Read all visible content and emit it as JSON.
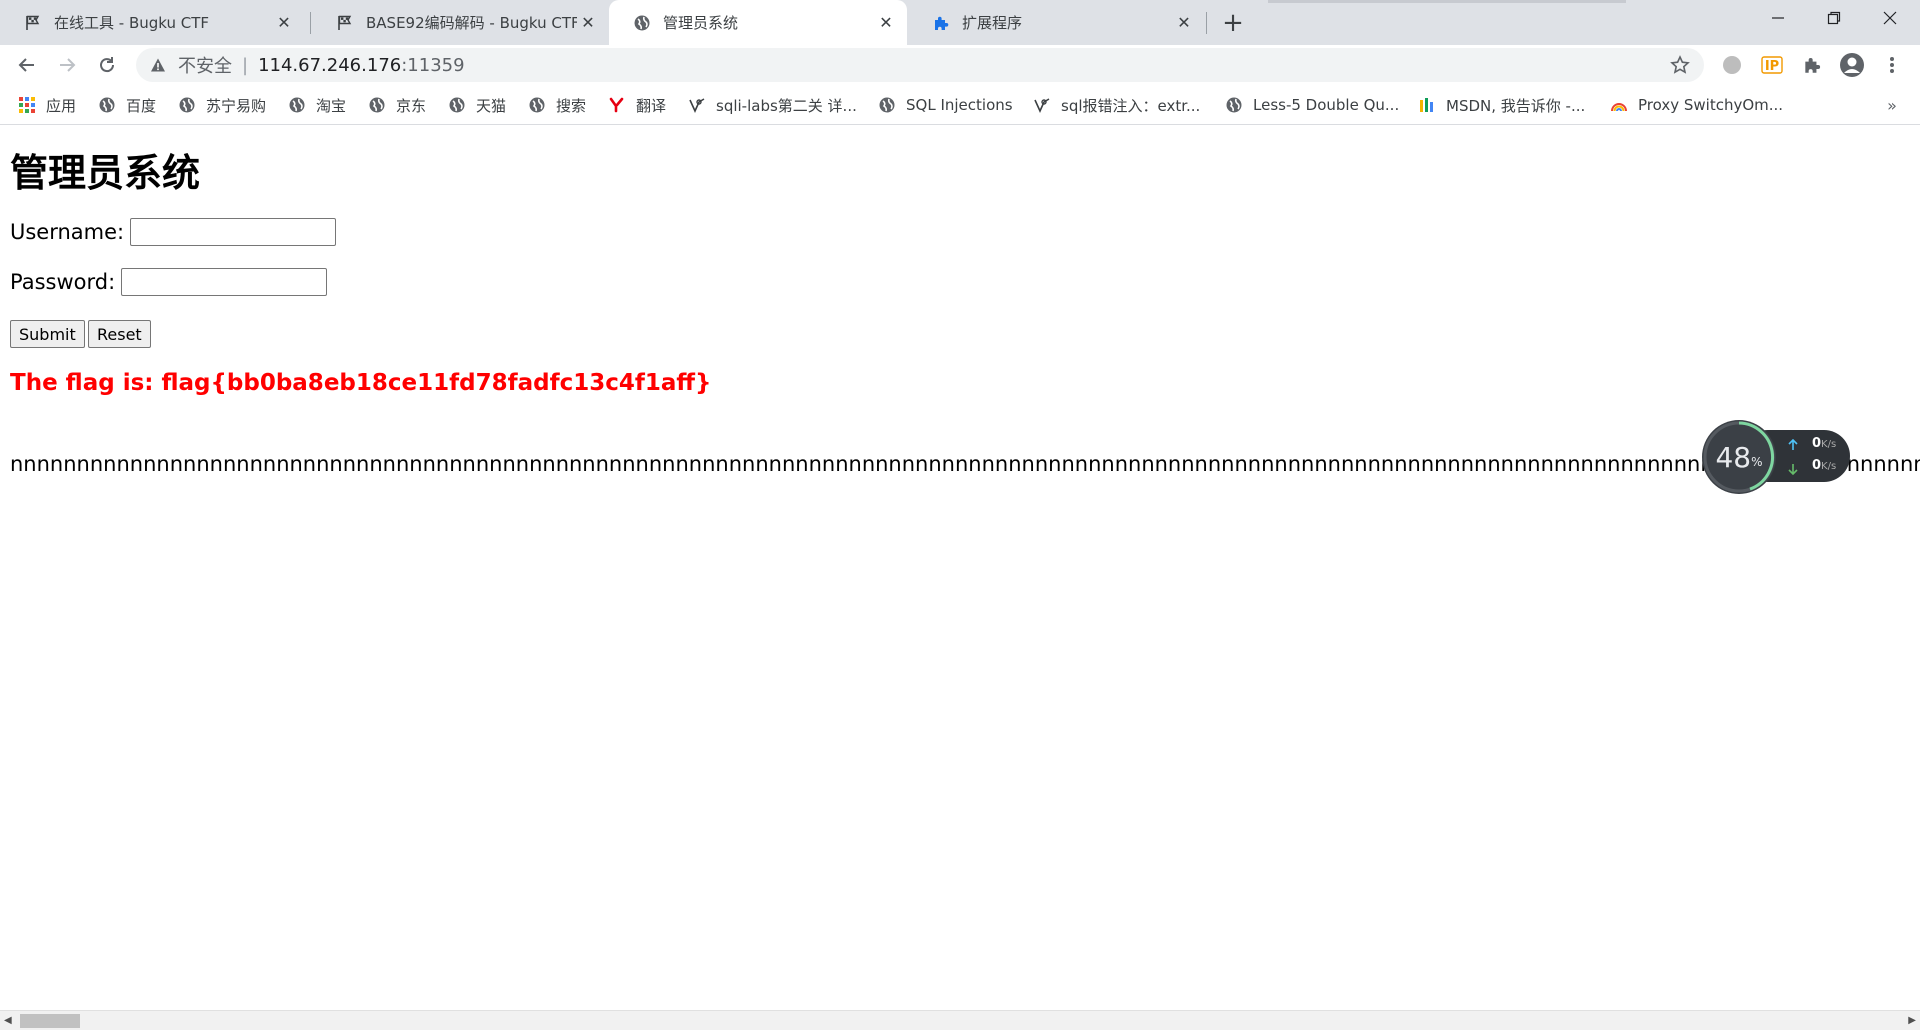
{
  "tabs": [
    {
      "title": "在线工具 - Bugku CTF",
      "icon": "flag-icon"
    },
    {
      "title": "BASE92编码解码 - Bugku CTF",
      "icon": "flag-icon"
    },
    {
      "title": "管理员系统",
      "icon": "globe-icon"
    },
    {
      "title": "扩展程序",
      "icon": "puzzle-icon"
    }
  ],
  "close_glyph": "✕",
  "newtab_glyph": "+",
  "omnibox": {
    "security_label": "不安全",
    "divider": "|",
    "url_host": "114.67.246.176",
    "url_port": ":11359"
  },
  "bookmarks": [
    {
      "label": "应用",
      "icon": "apps-grid-icon"
    },
    {
      "label": "百度",
      "icon": "globe-icon"
    },
    {
      "label": "苏宁易购",
      "icon": "globe-icon"
    },
    {
      "label": "淘宝",
      "icon": "globe-icon"
    },
    {
      "label": "京东",
      "icon": "globe-icon"
    },
    {
      "label": "天猫",
      "icon": "globe-icon"
    },
    {
      "label": "搜索",
      "icon": "globe-icon"
    },
    {
      "label": "翻译",
      "icon": "youdao-icon"
    },
    {
      "label": "sqli-labs第二关 详...",
      "icon": "sqli-icon"
    },
    {
      "label": "SQL Injections",
      "icon": "globe-icon"
    },
    {
      "label": "sql报错注入：extr...",
      "icon": "sqli-icon"
    },
    {
      "label": "Less-5 Double Qu...",
      "icon": "globe-icon"
    },
    {
      "label": "MSDN, 我告诉你 -...",
      "icon": "msdn-icon"
    },
    {
      "label": "Proxy SwitchyOm...",
      "icon": "rainbow-icon"
    }
  ],
  "bookmarks_more": "»",
  "page": {
    "heading": "管理员系统",
    "username_label": "Username:",
    "password_label": "Password:",
    "username_value": "",
    "password_value": "",
    "submit_label": "Submit",
    "reset_label": "Reset",
    "flag_text": "The flag is: flag{bb0ba8eb18ce11fd78fadfc13c4f1aff}",
    "long_text": "nnnnnnnnnnnnnnnnnnnnnnnnnnnnnnnnnnnnnnnnnnnnnnnnnnnnnnnnnnnnnnnnnnnnnnnnnnnnnnnnnnnnnnnnnnnnnnnnnnnnnnnnnnnnnnnnnnnnnnnnnnnnnnnnnnnnnnnnnnnnnnnnnnnnnnnnnnnnnnnnnnnnnnnnnnnnnnnnnnnnnnnnnnnnnnnnnnnnnnnnnnnnnnnnnnnnnnnnnnnnnnnnnnnnnnnnnnnnnnnnnnnnnnnnnnnnnnnn"
  },
  "speed_widget": {
    "value": "48",
    "unit": "%",
    "up_value": "0",
    "down_value": "0",
    "rate_unit": "K/s"
  },
  "colors": {
    "flag_red": "#ff0000",
    "tabstrip_bg": "#dee1e6",
    "omnibox_bg": "#f1f3f4"
  }
}
